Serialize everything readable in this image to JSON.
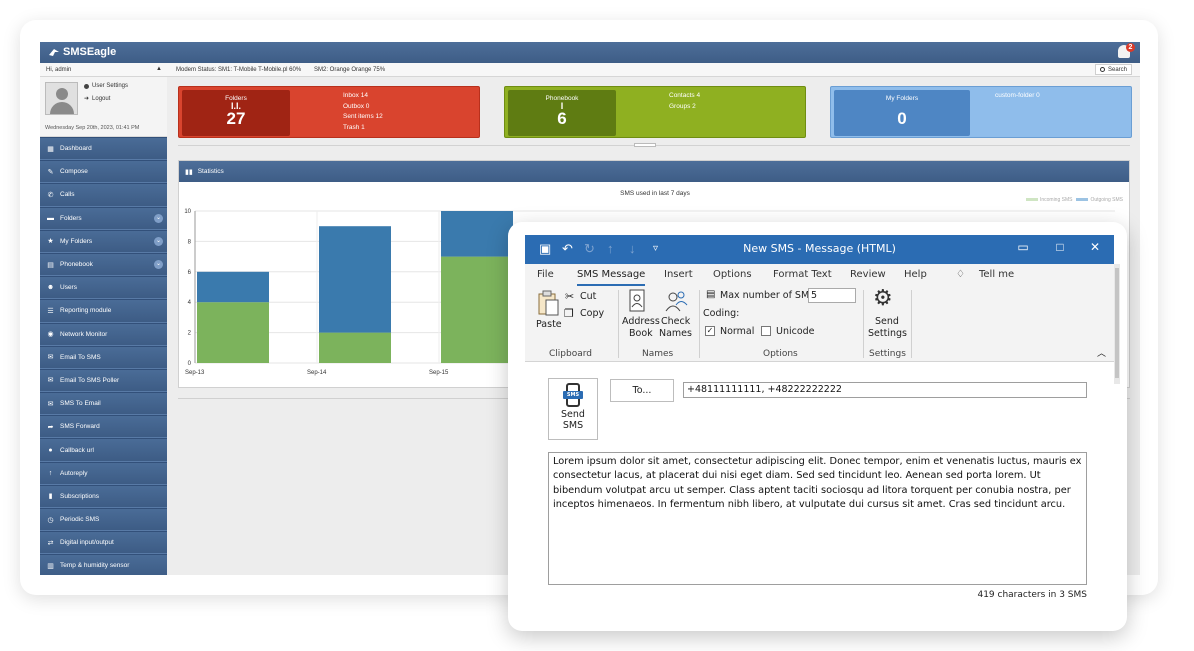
{
  "web": {
    "brand": "SMSEagle",
    "notifications_count": "2",
    "greeting": "Hi, admin",
    "modem_status": "Modem Status: SM1: T-Mobile T-Mobile.pl 60%",
    "modem_status2": "SM2: Orange Orange 75%",
    "search_label": "Search",
    "profile": {
      "user_settings": "User Settings",
      "logout": "Logout",
      "date": "Wednesday Sep 20th, 2023, 01:41 PM"
    },
    "menu": [
      {
        "label": "Dashboard",
        "icon": "▦",
        "chevron": false
      },
      {
        "label": "Compose",
        "icon": "✎",
        "chevron": false
      },
      {
        "label": "Calls",
        "icon": "✆",
        "chevron": false
      },
      {
        "label": "Folders",
        "icon": "▬",
        "chevron": true
      },
      {
        "label": "My Folders",
        "icon": "★",
        "chevron": true
      },
      {
        "label": "Phonebook",
        "icon": "▤",
        "chevron": true
      },
      {
        "label": "Users",
        "icon": "☻",
        "chevron": false
      },
      {
        "label": "Reporting module",
        "icon": "☰",
        "chevron": false
      },
      {
        "label": "Network Monitor",
        "icon": "◉",
        "chevron": false
      },
      {
        "label": "Email To SMS",
        "icon": "✉",
        "chevron": false
      },
      {
        "label": "Email To SMS Poller",
        "icon": "✉",
        "chevron": false
      },
      {
        "label": "SMS To Email",
        "icon": "✉",
        "chevron": false
      },
      {
        "label": "SMS Forward",
        "icon": "➦",
        "chevron": false
      },
      {
        "label": "Callback url",
        "icon": "●",
        "chevron": false
      },
      {
        "label": "Autoreply",
        "icon": "↑",
        "chevron": false
      },
      {
        "label": "Subscriptions",
        "icon": "▮",
        "chevron": false
      },
      {
        "label": "Periodic SMS",
        "icon": "◷",
        "chevron": false
      },
      {
        "label": "Digital input/output",
        "icon": "⇄",
        "chevron": false
      },
      {
        "label": "Temp & humidity sensor",
        "icon": "▥",
        "chevron": false
      }
    ],
    "tiles": {
      "folders": {
        "title": "Folders",
        "value": "27",
        "info": [
          "Inbox 14",
          "Outbox 0",
          "Sent items 12",
          "Trash 1"
        ]
      },
      "phonebook": {
        "title": "Phonebook",
        "value": "6",
        "info": [
          "Contacts 4",
          "Groups 2"
        ]
      },
      "myfolders": {
        "title": "My Folders",
        "value": "0",
        "info": [
          "custom-folder 0"
        ]
      }
    },
    "colors": {
      "folders": "#d9442e",
      "phonebook": "#8fb021",
      "myfolders": "#7fb0e6"
    },
    "stats": {
      "title": "Statistics",
      "chart_data": {
        "type": "bar",
        "title": "SMS used in last 7 days",
        "categories": [
          "Sep-13",
          "Sep-14",
          "Sep-15"
        ],
        "series": [
          {
            "name": "Incoming SMS",
            "values": [
              4,
              2,
              7
            ],
            "color": "#7cb35c"
          },
          {
            "name": "Outgoing SMS",
            "values": [
              2,
              7,
              3
            ],
            "color": "#3a7aad"
          }
        ],
        "yticks": [
          0,
          2,
          4,
          6,
          8,
          10
        ],
        "ylim": [
          0,
          10
        ],
        "stacked": true,
        "grid": true,
        "legend": "top-right"
      }
    }
  },
  "outlook": {
    "caption": "New SMS  -  Message (HTML)",
    "tabs": [
      "File",
      "SMS Message",
      "Insert",
      "Options",
      "Format Text",
      "Review",
      "Help",
      "Tell me"
    ],
    "ribbon": {
      "paste": "Paste",
      "cut": "Cut",
      "copy": "Copy",
      "clipboard": "Clipboard",
      "address_book_1": "Address",
      "address_book_2": "Book",
      "check_names_1": "Check",
      "check_names_2": "Names",
      "names": "Names",
      "max_sms_label": "Max number of SMS",
      "max_sms_value": "5",
      "coding": "Coding:",
      "normal": "Normal",
      "unicode": "Unicode",
      "options": "Options",
      "send_settings_1": "Send",
      "send_settings_2": "Settings",
      "settings": "Settings"
    },
    "send_label_1": "Send",
    "send_label_2": "SMS",
    "sms_badge": "SMS",
    "to_label": "To...",
    "recipients": "+48111111111, +48222222222",
    "body": "Lorem ipsum dolor sit amet, consectetur adipiscing elit. Donec tempor, enim et venenatis luctus, mauris ex consectetur lacus, at placerat dui nisi eget diam. Sed sed tincidunt leo. Aenean sed porta lorem. Ut bibendum volutpat arcu ut semper. Class aptent taciti sociosqu ad litora torquent per conubia nostra, per inceptos himenaeos. In fermentum nibh libero, at vulputate dui cursus sit amet. Cras sed tincidunt arcu.",
    "counter": "419 characters in 3 SMS"
  }
}
